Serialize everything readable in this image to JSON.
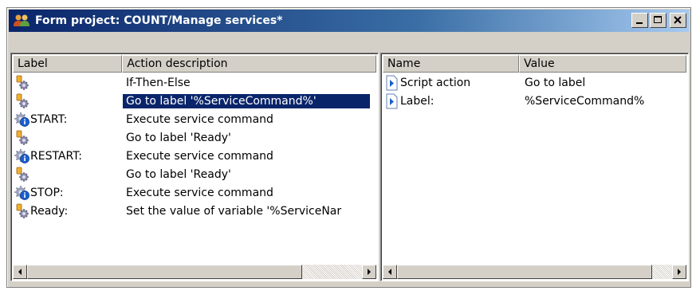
{
  "window": {
    "title": "Form project: COUNT/Manage services*",
    "buttons": {
      "minimize": "minimize-icon",
      "maximize": "maximize-icon",
      "close": "close-icon"
    }
  },
  "left_pane": {
    "columns": [
      "Label",
      "Action description"
    ],
    "rows": [
      {
        "icon": "action-gear-icon",
        "label": "",
        "action": "If-Then-Else",
        "selected": false
      },
      {
        "icon": "action-gear-icon",
        "label": "",
        "action": "Go to label '%ServiceCommand%'",
        "selected": true
      },
      {
        "icon": "service-gear-info-icon",
        "label": "START:",
        "action": "Execute service command",
        "selected": false
      },
      {
        "icon": "action-gear-icon",
        "label": "",
        "action": "Go to label 'Ready'",
        "selected": false
      },
      {
        "icon": "service-gear-info-icon",
        "label": "RESTART:",
        "action": "Execute service command",
        "selected": false
      },
      {
        "icon": "action-gear-icon",
        "label": "",
        "action": "Go to label 'Ready'",
        "selected": false
      },
      {
        "icon": "service-gear-info-icon",
        "label": "STOP:",
        "action": "Execute service command",
        "selected": false
      },
      {
        "icon": "action-gear-icon",
        "label": "Ready:",
        "action": "Set the value of variable '%ServiceNar",
        "selected": false
      }
    ]
  },
  "right_pane": {
    "columns": [
      "Name",
      "Value"
    ],
    "rows": [
      {
        "icon": "property-arrow-icon",
        "name": "Script action",
        "value": "Go to label"
      },
      {
        "icon": "property-arrow-icon",
        "name": "Label:",
        "value": "%ServiceCommand%"
      }
    ]
  },
  "colors": {
    "title_gradient_start": "#0a246a",
    "selection": "#0a246a",
    "window_face": "#d4d0c8"
  }
}
